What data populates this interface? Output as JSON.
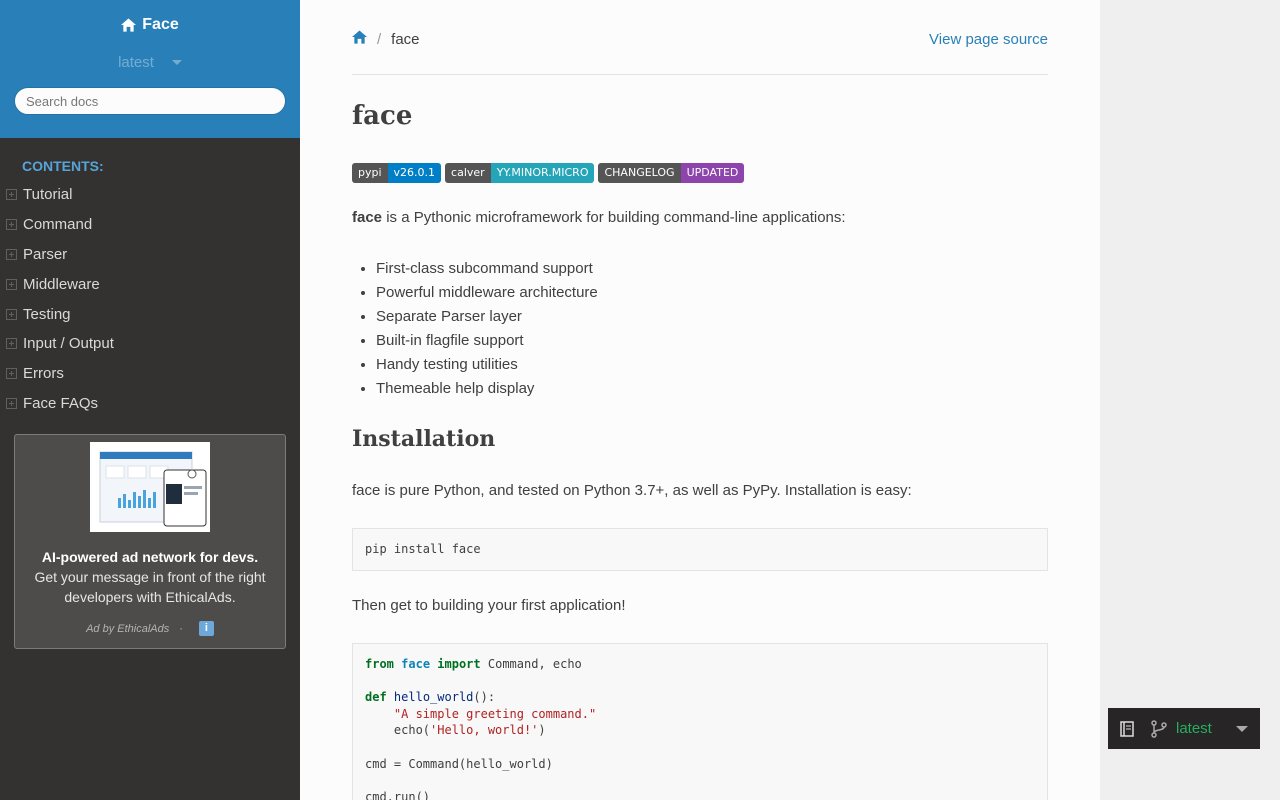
{
  "sidebar": {
    "brand": "Face",
    "version": "latest",
    "search_placeholder": "Search docs",
    "caption": "CONTENTS:",
    "items": [
      {
        "label": "Tutorial"
      },
      {
        "label": "Command"
      },
      {
        "label": "Parser"
      },
      {
        "label": "Middleware"
      },
      {
        "label": "Testing"
      },
      {
        "label": "Input / Output"
      },
      {
        "label": "Errors"
      },
      {
        "label": "Face FAQs"
      }
    ],
    "ad": {
      "bold": "AI-powered ad network for devs.",
      "text": " Get your message in front of the right developers with EthicalAds.",
      "by": "Ad by EthicalAds",
      "dot": "·",
      "info": "i"
    }
  },
  "breadcrumb": {
    "current": "face",
    "sep": "/",
    "source_link": "View page source"
  },
  "main": {
    "title": "face",
    "badges": [
      {
        "left": "pypi",
        "right": "v26.0.1",
        "color": "#007ec6"
      },
      {
        "left": "calver",
        "right": "YY.MINOR.MICRO",
        "color": "#24a5b8"
      },
      {
        "left": "CHANGELOG",
        "right": "UPDATED",
        "color": "#8e44ad"
      }
    ],
    "intro_bold": "face",
    "intro_rest": " is a Pythonic microframework for building command-line applications:",
    "features": [
      "First-class subcommand support",
      "Powerful middleware architecture",
      "Separate Parser layer",
      "Built-in flagfile support",
      "Handy testing utilities",
      "Themeable help display"
    ],
    "install_heading": "Installation",
    "install_text": "face is pure Python, and tested on Python 3.7+, as well as PyPy. Installation is easy:",
    "install_code": "pip install face",
    "build_text": "Then get to building your first application!",
    "code": {
      "l1_from": "from",
      "l1_mod": "face",
      "l1_import": "import",
      "l1_rest": " Command, echo",
      "l3_def": "def",
      "l3_fn": "hello_world",
      "l3_rest": "():",
      "l4_str": "\"A simple greeting command.\"",
      "l5_a": "echo(",
      "l5_str": "'Hello, world!'",
      "l5_b": ")",
      "l7": "cmd = Command(hello_world)",
      "l9": "cmd.run()"
    }
  },
  "version_switcher": {
    "version": "latest"
  }
}
